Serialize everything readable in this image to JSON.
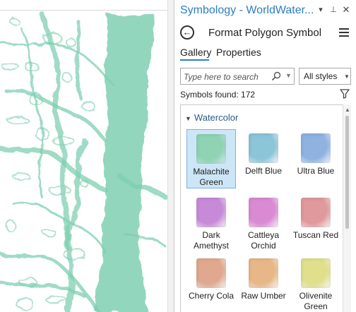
{
  "pane": {
    "title": "Symbology - WorldWater...",
    "subtitle": "Format Polygon Symbol",
    "tabs": {
      "gallery": "Gallery",
      "properties": "Properties"
    },
    "search_placeholder": "Type here to search",
    "styles_select": "All styles",
    "symbols_found": "Symbols found: 172"
  },
  "gallery": {
    "group_name": "Watercolor",
    "symbols": [
      {
        "name": "Malachite\nGreen",
        "color": "#8fd3b4",
        "selected": true
      },
      {
        "name": "Delft Blue",
        "color": "#8cc4d8",
        "selected": false
      },
      {
        "name": "Ultra Blue",
        "color": "#8fb2e0",
        "selected": false
      },
      {
        "name": "Dark\nAmethyst",
        "color": "#c78ad8",
        "selected": false
      },
      {
        "name": "Cattleya\nOrchid",
        "color": "#d98ad2",
        "selected": false
      },
      {
        "name": "Tuscan Red",
        "color": "#e0999c",
        "selected": false
      },
      {
        "name": "Cherry Cola",
        "color": "#e0a88e",
        "selected": false
      },
      {
        "name": "Raw Umber",
        "color": "#e8b787",
        "selected": false
      },
      {
        "name": "Olivenite\nGreen",
        "color": "#e0e08c",
        "selected": false
      }
    ]
  },
  "map": {
    "water_color": "#7fcfb2"
  }
}
